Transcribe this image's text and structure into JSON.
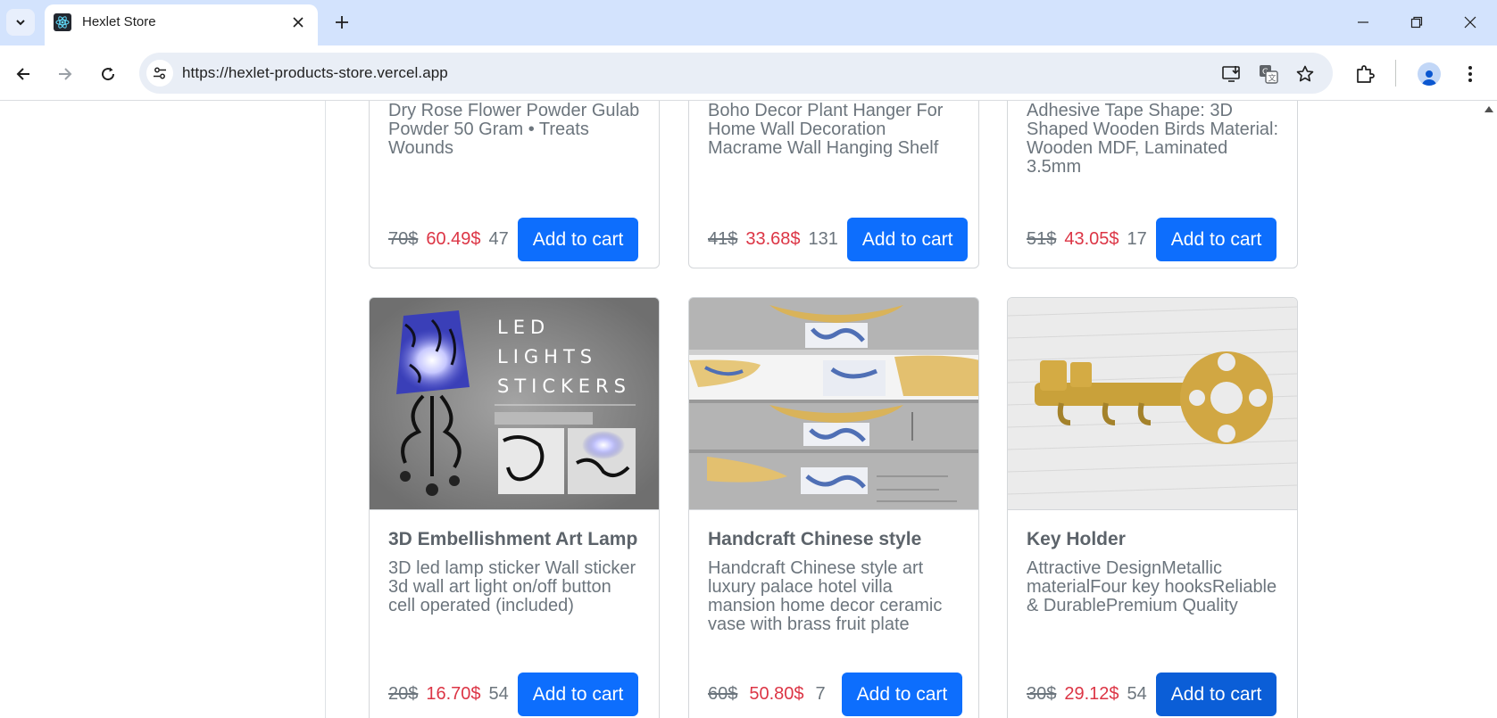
{
  "browser": {
    "tab_title": "Hexlet Store",
    "url": "https://hexlet-products-store.vercel.app"
  },
  "products_top": [
    {
      "desc": "Dry Rose Flower Powder Gulab Powder 50 Gram • Treats Wounds",
      "old_price": "70$",
      "new_price": "60.49$",
      "stock": "47",
      "button": "Add to cart"
    },
    {
      "desc": "Boho Decor Plant Hanger For Home Wall Decoration Macrame Wall Hanging Shelf",
      "old_price": "41$",
      "new_price": "33.68$",
      "stock": "131",
      "button": "Add to cart"
    },
    {
      "desc": "Adhesive Tape Shape: 3D Shaped Wooden Birds Material: Wooden MDF, Laminated 3.5mm",
      "old_price": "51$",
      "new_price": "43.05$",
      "stock": "17",
      "button": "Add to cart"
    }
  ],
  "products": [
    {
      "title": "3D Embellishment Art Lamp",
      "desc": "3D led lamp sticker Wall sticker 3d wall art light on/off button cell operated (included)",
      "old_price": "20$",
      "new_price": "16.70$",
      "stock": "54",
      "button": "Add to cart",
      "image_text": [
        "LED",
        "LIGHTS",
        "STICKERS"
      ]
    },
    {
      "title": "Handcraft Chinese style",
      "desc": "Handcraft Chinese style art luxury palace hotel villa mansion home decor ceramic vase with brass fruit plate",
      "old_price": "60$",
      "new_price": "50.80$",
      "stock": "7",
      "button": "Add to cart"
    },
    {
      "title": "Key Holder",
      "desc": "Attractive DesignMetallic materialFour key hooksReliable & DurablePremium Quality",
      "old_price": "30$",
      "new_price": "29.12$",
      "stock": "54",
      "button": "Add to cart"
    }
  ]
}
